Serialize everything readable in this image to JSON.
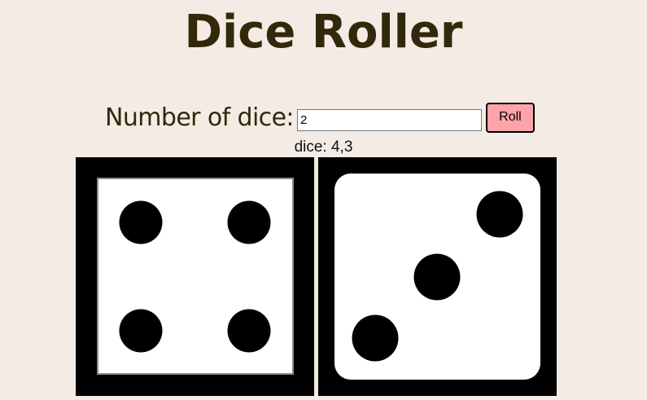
{
  "app": {
    "title": "Dice Roller"
  },
  "controls": {
    "label": "Number of dice:",
    "input_value": "2",
    "roll_label": "Roll"
  },
  "result": {
    "text": "dice: 4,3",
    "values": [
      4,
      3
    ]
  },
  "dice": [
    {
      "value": 4,
      "face": "square-corners"
    },
    {
      "value": 3,
      "face": "rounded-corners"
    }
  ],
  "colors": {
    "background": "#f4ece4",
    "title": "#33280a",
    "roll_button": "#ffa3aa",
    "die_frame": "#000000",
    "die_face": "#ffffff",
    "pip": "#000000"
  }
}
